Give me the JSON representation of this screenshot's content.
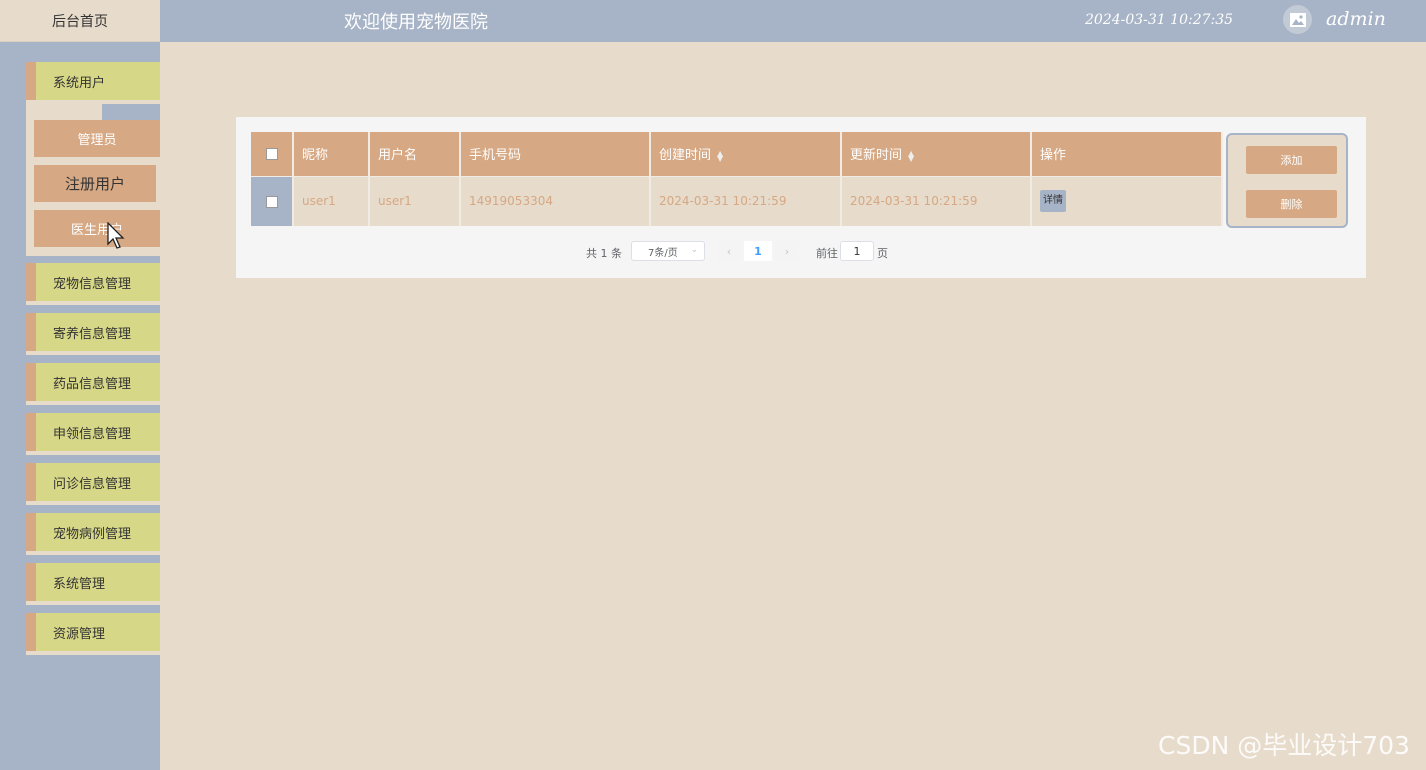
{
  "header": {
    "home_tab": "后台首页",
    "title": "欢迎使用宠物医院",
    "datetime": "2024-03-31 10:27:35",
    "username": "admin",
    "avatar_icon": "image-icon"
  },
  "sidebar": {
    "items": [
      {
        "label": "系统用户"
      },
      {
        "label": "宠物信息管理"
      },
      {
        "label": "寄养信息管理"
      },
      {
        "label": "药品信息管理"
      },
      {
        "label": "申领信息管理"
      },
      {
        "label": "问诊信息管理"
      },
      {
        "label": "宠物病例管理"
      },
      {
        "label": "系统管理"
      },
      {
        "label": "资源管理"
      }
    ],
    "submenu": [
      {
        "label": "管理员"
      },
      {
        "label": "注册用户",
        "active": true
      },
      {
        "label": "医生用户"
      }
    ]
  },
  "table": {
    "columns": [
      "昵称",
      "用户名",
      "手机号码",
      "创建时间",
      "更新时间",
      "操作"
    ],
    "rows": [
      {
        "nickname": "user1",
        "username": "user1",
        "phone": "14919053304",
        "created": "2024-03-31 10:21:59",
        "updated": "2024-03-31 10:21:59",
        "action": "详情"
      }
    ]
  },
  "actions": {
    "add": "添加",
    "delete": "删除"
  },
  "pagination": {
    "total_text": "共 1 条",
    "page_size": "7条/页",
    "current_page": "1",
    "goto_label": "前往",
    "goto_value": "1",
    "page_unit": "页"
  },
  "watermark": "CSDN @毕业设计703",
  "colors": {
    "header_bg": "#a7b3c6",
    "page_bg": "#e7dbcb",
    "accent": "#d6a883",
    "menu_bg": "#d6d787"
  }
}
